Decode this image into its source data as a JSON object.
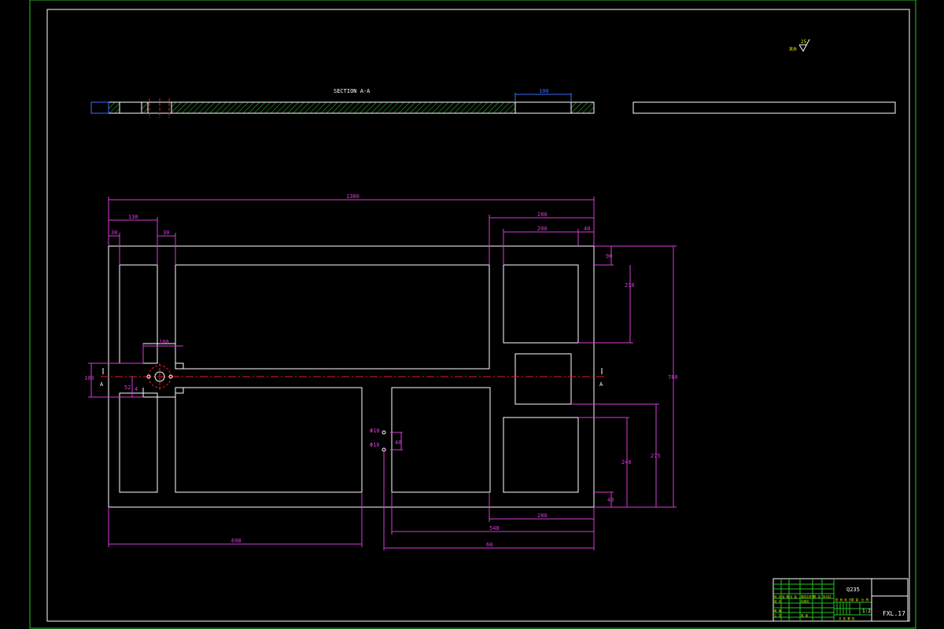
{
  "section_title": "SECTION A-A",
  "section_dim": "100",
  "roughness": {
    "value": "25",
    "note": "其余"
  },
  "cut_labels": {
    "left": "A",
    "right": "A"
  },
  "holes": {
    "a": "Φ10",
    "b": "Φ10"
  },
  "dims": {
    "overall_w": "1380",
    "left_130": "130",
    "left_30": "30",
    "left_30b": "30",
    "right_280": "280",
    "right_200": "200",
    "right_40": "40",
    "r_90": "90",
    "r_210": "210",
    "r_780": "780",
    "r_275": "275",
    "r_240": "240",
    "r_40b": "40",
    "b_280": "280",
    "b_548": "548",
    "b_698": "698",
    "b_60": "60",
    "cross_100": "100",
    "left_100": "100",
    "left_52": "52",
    "left_4": "4",
    "hole_40": "40"
  },
  "title_block": {
    "material": "Q235",
    "scale": "1:2",
    "drawing_no": "FXL.17",
    "left_labels": [
      "标 记",
      "处 数",
      "分 区",
      "更改文件号",
      "签 名",
      "年月日"
    ],
    "left_labels2": [
      "设 计",
      "标准化",
      "审 核",
      "工 艺",
      "批 准"
    ],
    "mid_labels": [
      "阶 段 标 记",
      "重 量",
      "比 例"
    ],
    "sheet": "共 张 第 张"
  }
}
